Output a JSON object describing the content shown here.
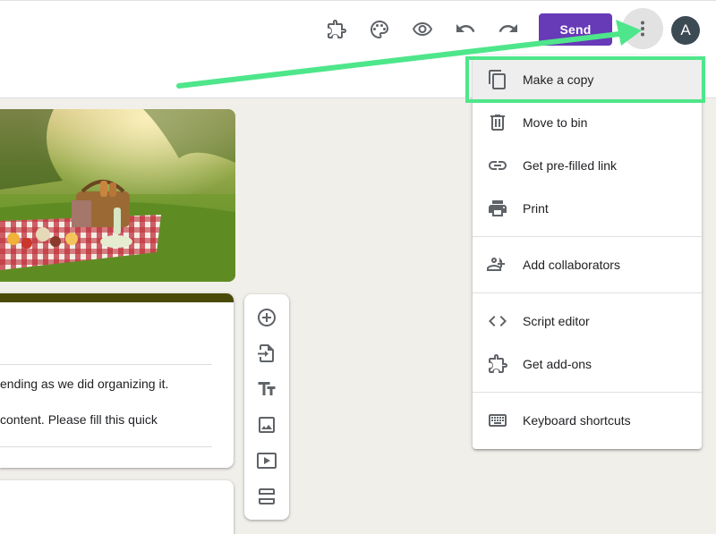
{
  "toolbar": {
    "icons": [
      "addons-icon",
      "palette-icon",
      "preview-icon",
      "undo-icon",
      "redo-icon"
    ],
    "send_label": "Send",
    "avatar_initial": "A"
  },
  "form": {
    "description_line1": "ending as we did organizing it.",
    "description_line2": "content. Please fill this quick"
  },
  "floating_toolbar": {
    "icons": [
      "add-question-icon",
      "import-questions-icon",
      "add-title-icon",
      "add-image-icon",
      "add-video-icon",
      "add-section-icon"
    ]
  },
  "menu": {
    "items": [
      {
        "label": "Make a copy",
        "icon": "copy-icon"
      },
      {
        "label": "Move to bin",
        "icon": "trash-icon"
      },
      {
        "label": "Get pre-filled link",
        "icon": "link-icon"
      },
      {
        "label": "Print",
        "icon": "printer-icon"
      },
      {
        "label": "Add collaborators",
        "icon": "add-people-icon"
      },
      {
        "label": "Script editor",
        "icon": "code-icon"
      },
      {
        "label": "Get add-ons",
        "icon": "puzzle-icon"
      },
      {
        "label": "Keyboard shortcuts",
        "icon": "keyboard-icon"
      }
    ]
  },
  "colors": {
    "send_button": "#673ab7",
    "form_accent": "#4a4a08",
    "annotation_green": "#4ee68a"
  }
}
